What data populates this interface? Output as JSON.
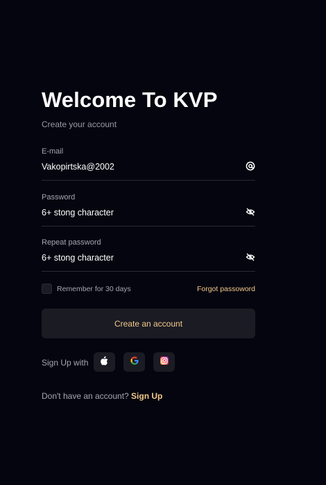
{
  "header": {
    "title": "Welcome To KVP",
    "subtitle": "Create your account"
  },
  "form": {
    "email": {
      "label": "E-mail",
      "value": "Vakopirtska@2002",
      "icon": "at-icon"
    },
    "password": {
      "label": "Password",
      "value": "6+ stong character",
      "icon": "eye-off-icon"
    },
    "repeat_password": {
      "label": "Repeat password",
      "value": "6+ stong character",
      "icon": "eye-off-icon"
    },
    "remember_label": "Remember for 30 days",
    "remember_checked": false,
    "forgot_label": "Forgot passoword",
    "submit_label": "Create an account"
  },
  "social": {
    "label": "Sign Up with",
    "providers": [
      "apple-icon",
      "google-icon",
      "instagram-icon"
    ]
  },
  "footer": {
    "prompt": "Don't have an account? ",
    "link": "Sign Up"
  },
  "colors": {
    "background": "#05050f",
    "accent": "#f2c98a",
    "surface": "#1b1b24",
    "divider": "#2a2a36"
  }
}
